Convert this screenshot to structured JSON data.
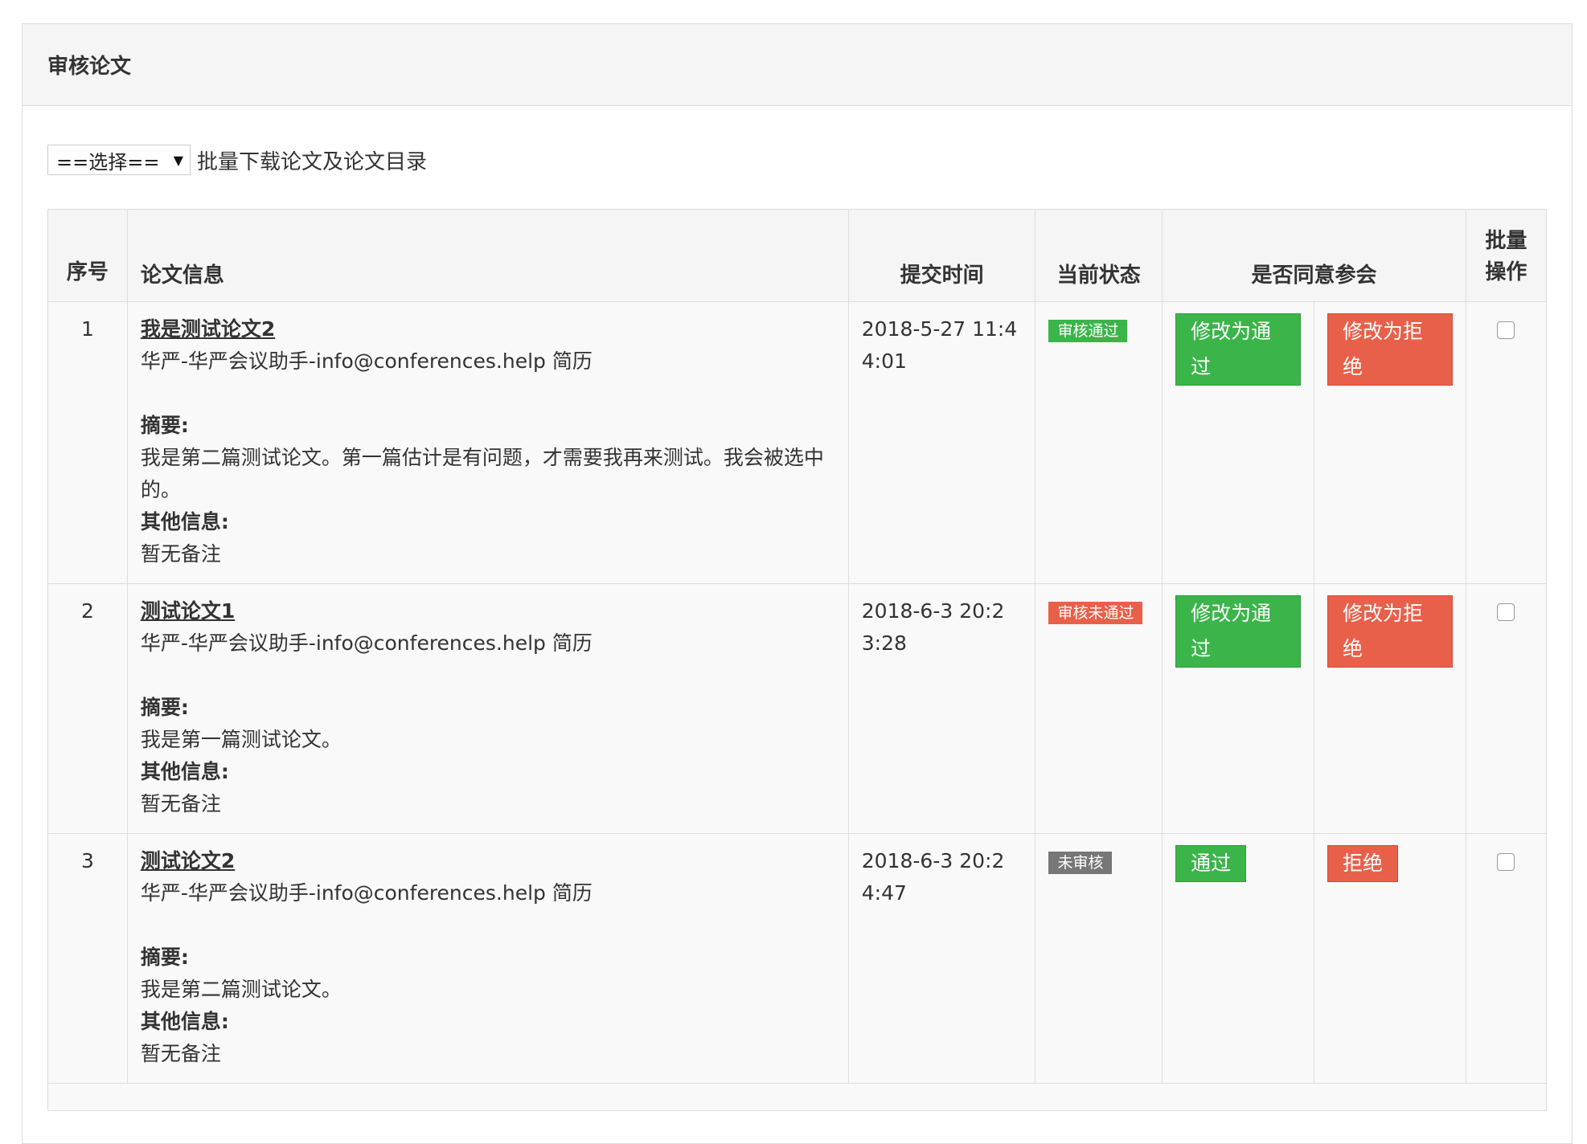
{
  "panel": {
    "title": "审核论文"
  },
  "toolbar": {
    "select_value": "==选择==",
    "label": "批量下载论文及论文目录"
  },
  "table": {
    "headers": {
      "seq": "序号",
      "info": "论文信息",
      "time": "提交时间",
      "state": "当前状态",
      "agree": "是否同意参会",
      "batch": "批量操作"
    },
    "rows": [
      {
        "seq": "1",
        "title": "我是测试论文2",
        "author": "华严-华严会议助手-info@conferences.help 简历",
        "abstract_label": "摘要:",
        "abstract": "我是第二篇测试论文。第一篇估计是有问题，才需要我再来测试。我会被选中的。",
        "other_label": "其他信息:",
        "other": "暂无备注",
        "time": "2018-5-27 11:44:01",
        "status": "审核通过",
        "approve": "修改为通过",
        "reject": "修改为拒绝",
        "status_color": "#3bb54a"
      },
      {
        "seq": "2",
        "title": "测试论文1",
        "author": "华严-华严会议助手-info@conferences.help 简历",
        "abstract_label": "摘要:",
        "abstract": "我是第一篇测试论文。",
        "other_label": "其他信息:",
        "other": "暂无备注",
        "time": "2018-6-3 20:23:28",
        "status": "审核未通过",
        "approve": "修改为通过",
        "reject": "修改为拒绝",
        "status_color": "#e8604a"
      },
      {
        "seq": "3",
        "title": "测试论文2",
        "author": "华严-华严会议助手-info@conferences.help 简历",
        "abstract_label": "摘要:",
        "abstract": "我是第二篇测试论文。",
        "other_label": "其他信息:",
        "other": "暂无备注",
        "time": "2018-6-3 20:24:47",
        "status": "未审核",
        "approve": "通过",
        "reject": "拒绝",
        "status_color": "#777777"
      }
    ]
  },
  "colors": {
    "approve": "#3bb54a",
    "reject": "#e8604a",
    "pending": "#777777"
  }
}
